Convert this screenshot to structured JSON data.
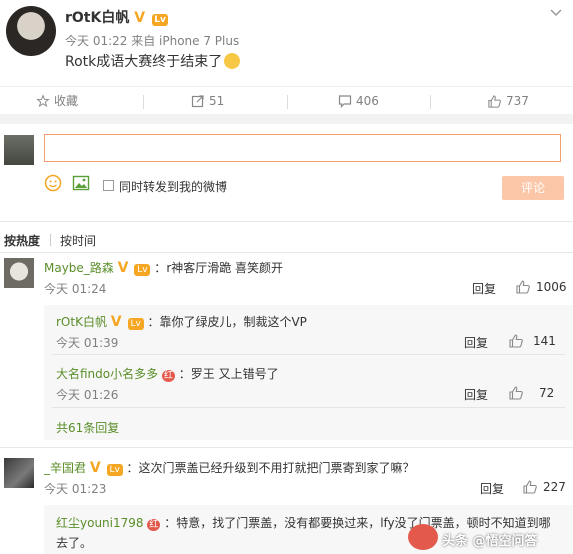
{
  "post": {
    "author": "rOtK白帆",
    "meta": "今天 01:22 来自 iPhone 7 Plus",
    "text": "Rotk成语大赛终于结束了",
    "badge_level": "Lv"
  },
  "actions": {
    "favorite": "收藏",
    "repost": "51",
    "comment": "406",
    "like": "737"
  },
  "composer": {
    "placeholder": "",
    "repost_label": "同时转发到我的微博",
    "submit": "评论"
  },
  "sort": {
    "hot": "按热度",
    "time": "按时间"
  },
  "comments": [
    {
      "user": "Maybe_路森",
      "text": "r神客厅滑跪 喜笑颜开",
      "time": "今天 01:24",
      "reply": "回复",
      "likes": "1006"
    },
    {
      "user": "_辛国君",
      "text": "这次门票盖已经升级到不用打就把门票寄到家了嘛？",
      "time": "今天 01:23",
      "reply": "回复",
      "likes": "227"
    }
  ],
  "subreplies": [
    {
      "user": "rOtK白帆",
      "text": "靠你了绿皮儿，制裁这个VP",
      "time": "今天 01:39",
      "reply": "回复",
      "likes": "141"
    },
    {
      "user": "大名findo小名多多",
      "text": "罗王 又上错号了",
      "time": "今天 01:26",
      "reply": "回复",
      "likes": "72"
    },
    {
      "user": "红尘youni1798",
      "text": "特意，找了门票盖，没有都要换过来，lfy没了门票盖，顿时不知道到哪去了。"
    }
  ],
  "expand_replies": "共61条回复",
  "watermark": "头条 @悟空问答",
  "colors": {
    "accent": "#eb7350",
    "username": "#5a8e2a",
    "badge": "#f5a623"
  }
}
